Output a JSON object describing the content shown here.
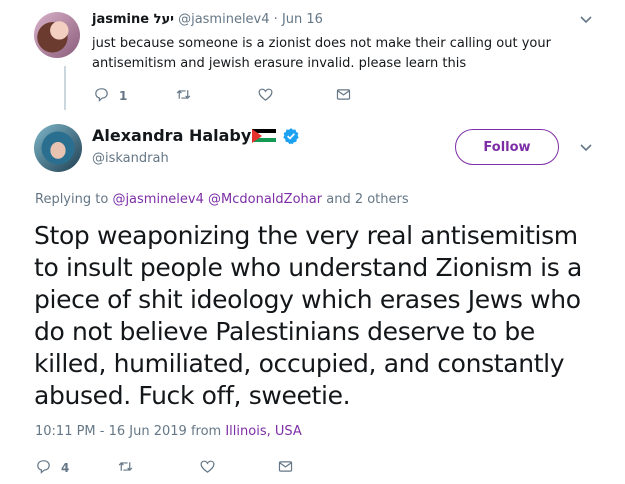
{
  "parent_tweet": {
    "name": "jasmine יעל",
    "handle": "@jasminelev4",
    "date": "Jun 16",
    "separator": "·",
    "text": "just because someone is a zionist does not make their calling out your antisemitism and jewish erasure invalid. please learn this",
    "actions": {
      "reply_count": "1",
      "retweet_count": "",
      "like_count": ""
    }
  },
  "main_tweet": {
    "name": "Alexandra Halaby",
    "handle": "@iskandrah",
    "follow_label": "Follow",
    "replying_prefix": "Replying to",
    "replying_user1": "@jasminelev4",
    "replying_user2": "@McdonaldZohar",
    "replying_suffix": "and 2 others",
    "text": "Stop weaponizing the very real antisemitism to insult people who understand Zionism is a piece of shit ideology which erases Jews who do not believe Palestinians deserve to be killed, humiliated, occupied, and constantly abused. Fuck off, sweetie.",
    "time": "10:11 PM - 16 Jun 2019 from",
    "location": "Illinois, USA",
    "actions": {
      "reply_count": "4",
      "retweet_count": "",
      "like_count": ""
    }
  },
  "icons": {
    "reply": "reply-icon",
    "retweet": "retweet-icon",
    "like": "heart-icon",
    "dm": "envelope-icon",
    "caret": "chevron-down-icon",
    "verified": "verified-badge-icon",
    "flag": "palestine-flag-icon"
  },
  "colors": {
    "accent": "#7d2ea6",
    "secondary_text": "#657786",
    "verified": "#1da1f2"
  }
}
